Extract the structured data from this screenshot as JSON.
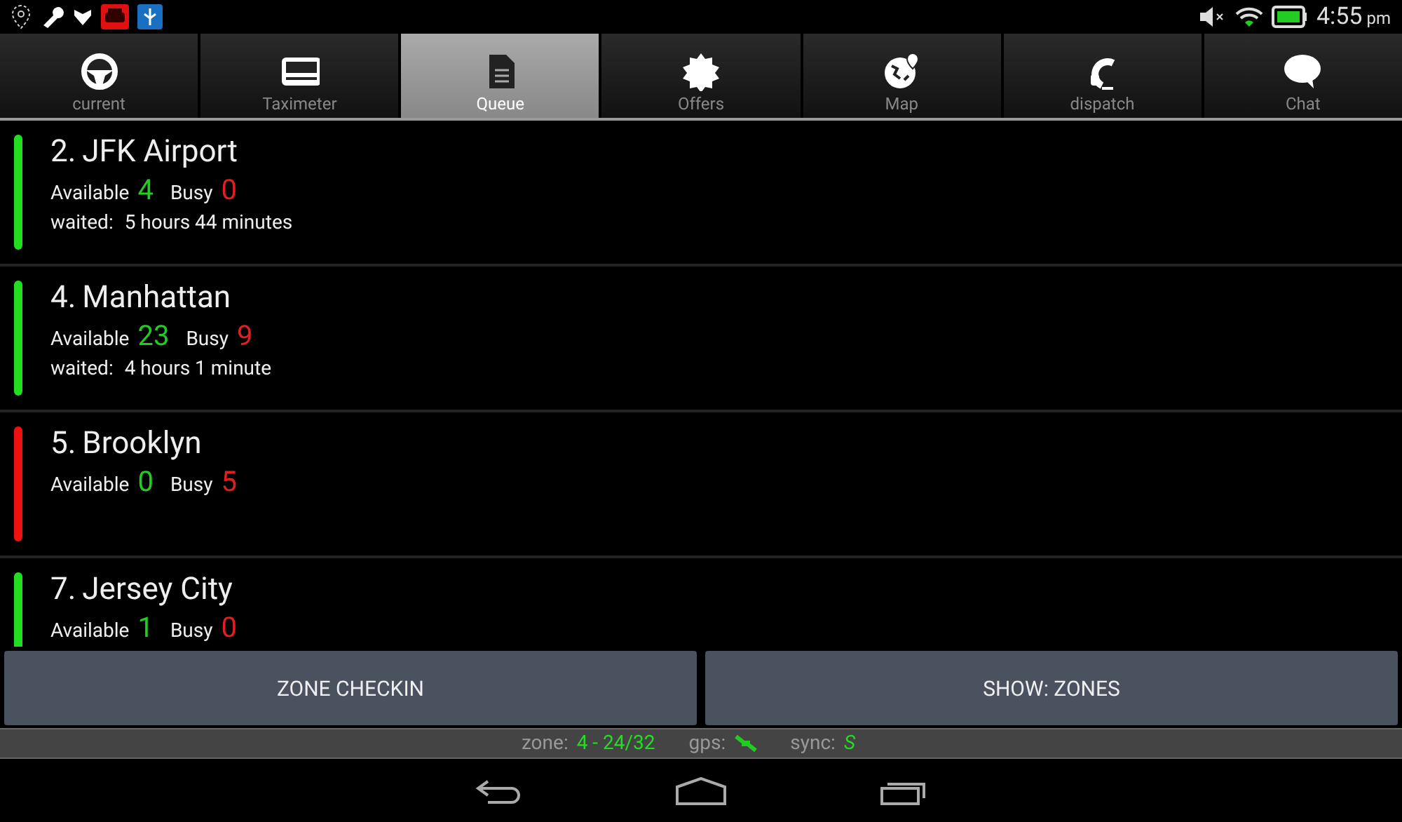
{
  "status_bar": {
    "time": "4:55",
    "ampm": "pm"
  },
  "tabs": [
    {
      "label": "current",
      "selected": false
    },
    {
      "label": "Taximeter",
      "selected": false
    },
    {
      "label": "Queue",
      "selected": true
    },
    {
      "label": "Offers",
      "selected": false
    },
    {
      "label": "Map",
      "selected": false
    },
    {
      "label": "dispatch",
      "selected": false
    },
    {
      "label": "Chat",
      "selected": false
    }
  ],
  "zones": [
    {
      "number": "2.",
      "name": "JFK Airport",
      "available_label": "Available",
      "available": "4",
      "busy_label": "Busy",
      "busy": "0",
      "waited_label": "waited:",
      "waited": "5 hours 44 minutes",
      "color": "#22dd22"
    },
    {
      "number": "4.",
      "name": "Manhattan",
      "available_label": "Available",
      "available": "23",
      "busy_label": "Busy",
      "busy": "9",
      "waited_label": "waited:",
      "waited": "4 hours 1 minute",
      "color": "#22dd22"
    },
    {
      "number": "5.",
      "name": "Brooklyn",
      "available_label": "Available",
      "available": "0",
      "busy_label": "Busy",
      "busy": "5",
      "color": "#ee1111"
    },
    {
      "number": "7.",
      "name": "Jersey City",
      "available_label": "Available",
      "available": "1",
      "busy_label": "Busy",
      "busy": "0",
      "color": "#22dd22"
    }
  ],
  "buttons": [
    "ZONE CHECKIN",
    "SHOW: ZONES"
  ],
  "footer": {
    "zone_label": "zone:",
    "zone": "4 - 24/32",
    "gps_label": "gps:",
    "sync_label": "sync:",
    "sync": "S"
  }
}
